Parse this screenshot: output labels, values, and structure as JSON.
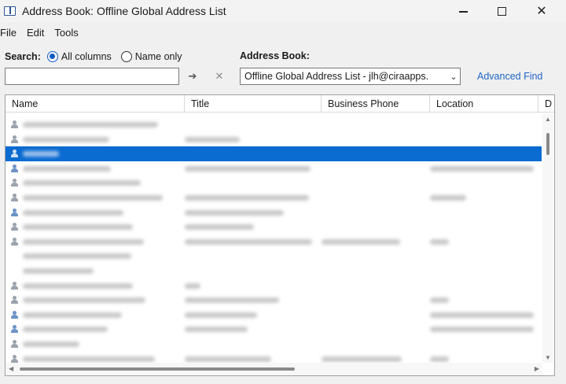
{
  "window": {
    "title": "Address Book: Offline Global Address List",
    "controls": {
      "minimize": "minimize-icon",
      "maximize": "maximize-icon",
      "close": "close-icon"
    }
  },
  "menu": [
    "File",
    "Edit",
    "Tools"
  ],
  "search": {
    "label": "Search:",
    "options": [
      {
        "label": "All columns",
        "selected": true
      },
      {
        "label": "Name only",
        "selected": false
      }
    ],
    "input_value": "",
    "go_icon": "arrow-right-icon",
    "clear_icon": "clear-x-icon"
  },
  "address_book": {
    "label": "Address Book:",
    "selected": "Offline Global Address List - jlh@ciraapps."
  },
  "advanced_find": "Advanced Find",
  "table": {
    "columns": [
      "Name",
      "Title",
      "Business Phone",
      "Location",
      "D"
    ],
    "selected_row_index": 2,
    "row_count": 17
  },
  "colors": {
    "selection": "#0a6bd1",
    "link": "#1f64c7",
    "radio_checked": "#0f5cc7"
  }
}
